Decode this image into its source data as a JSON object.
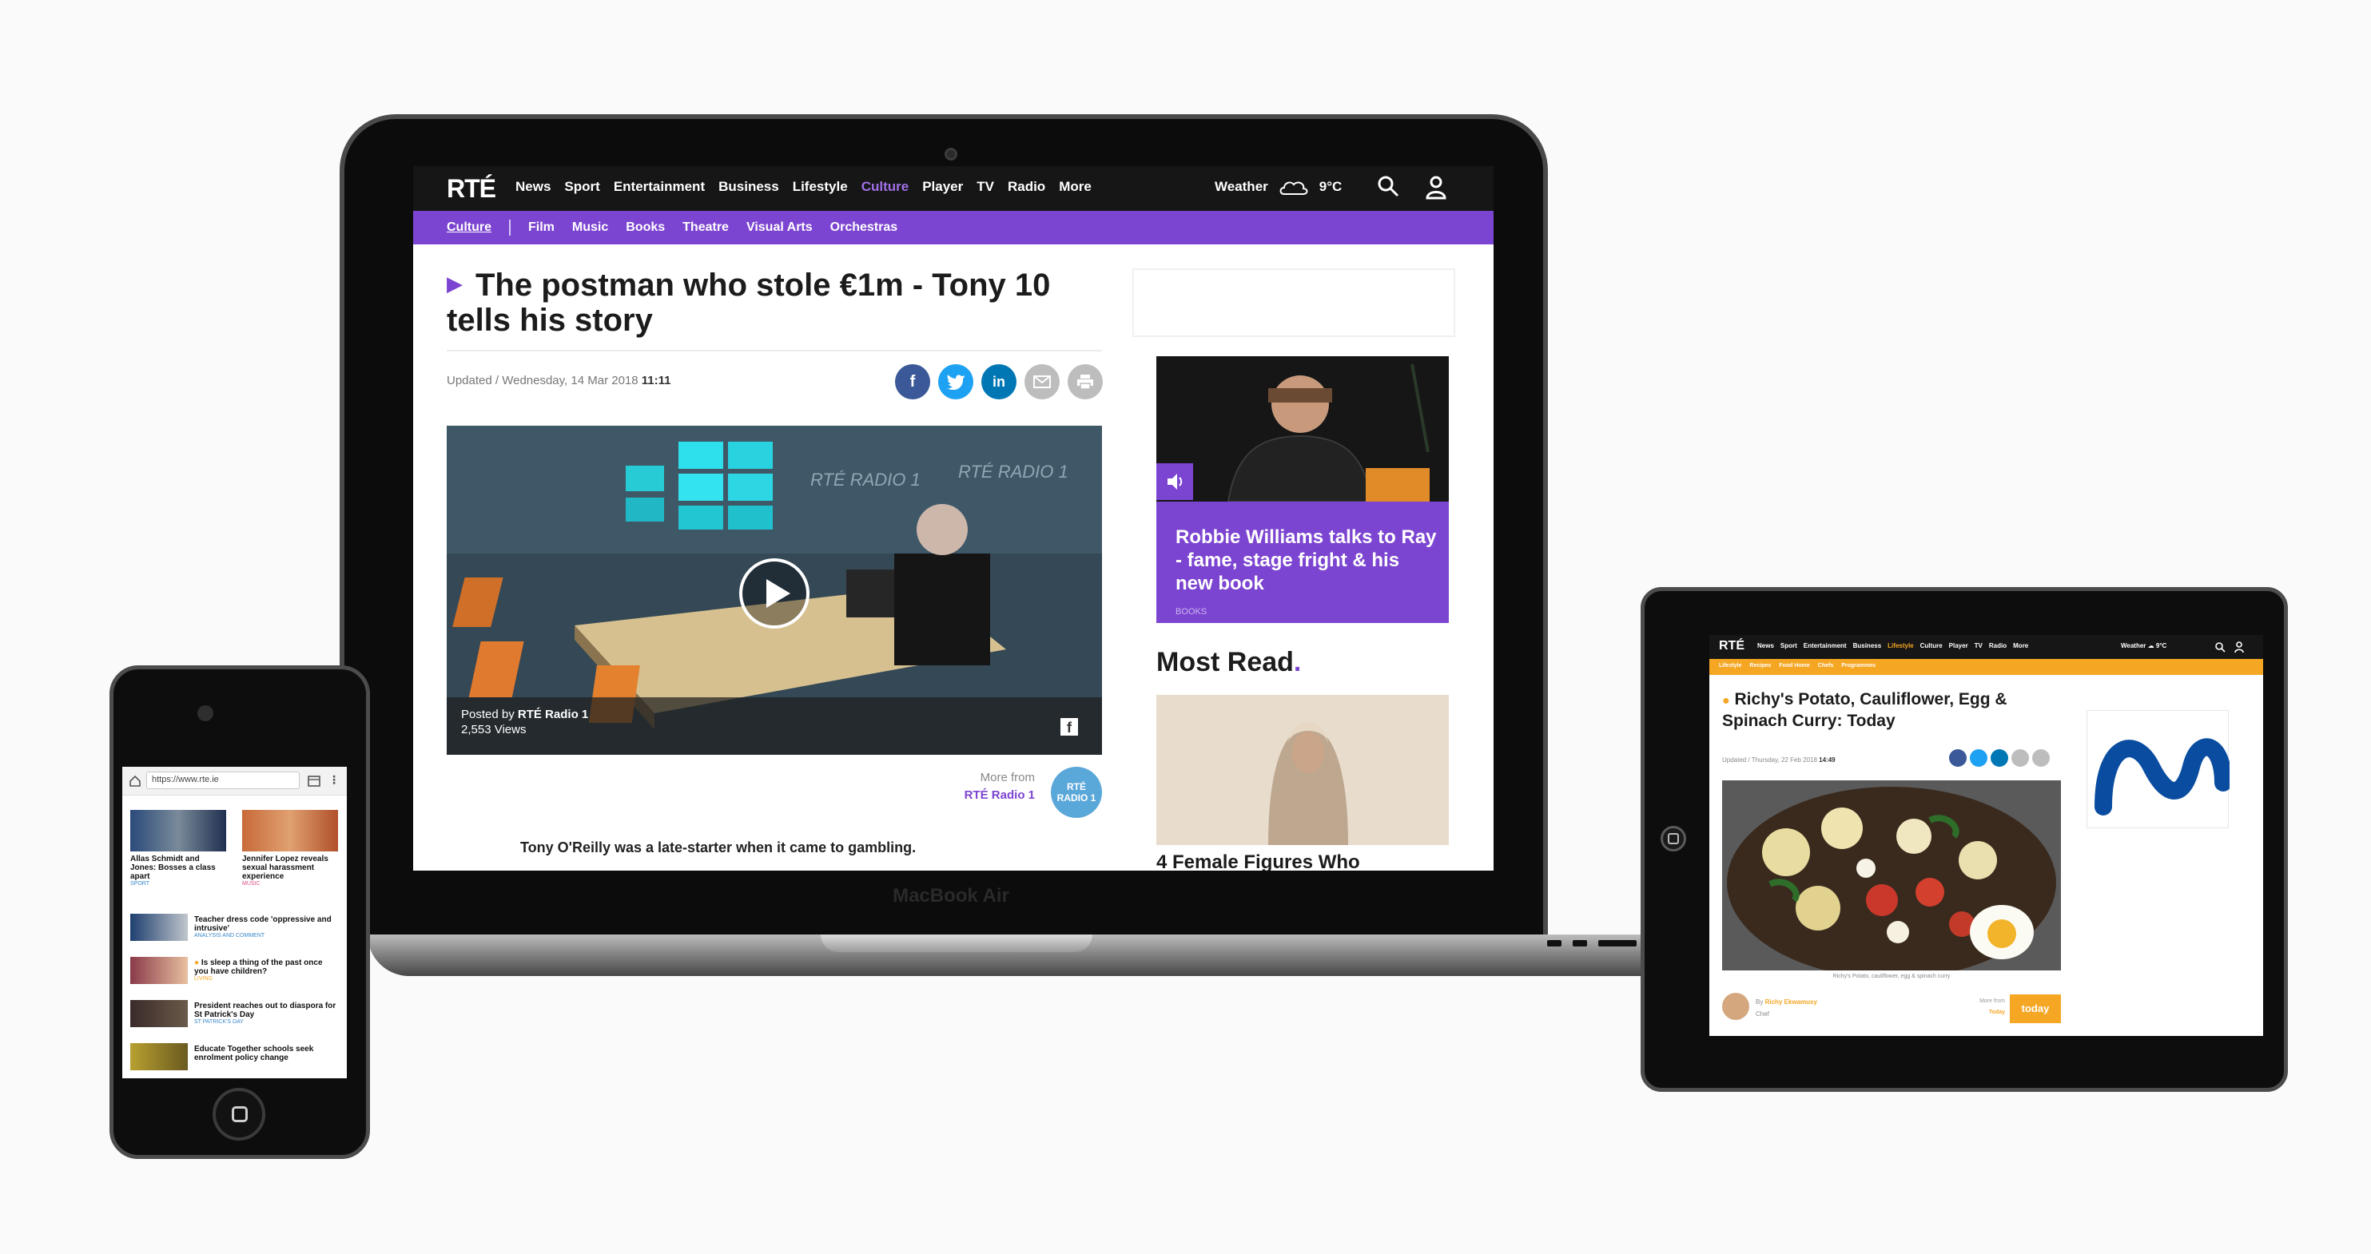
{
  "laptop": {
    "brand": "MacBook Air",
    "header": {
      "logo": "RTÉ",
      "nav": [
        "News",
        "Sport",
        "Entertainment",
        "Business",
        "Lifestyle",
        "Culture",
        "Player",
        "TV",
        "Radio",
        "More"
      ],
      "active_nav": "Culture",
      "weather_label": "Weather",
      "temperature": "9°C"
    },
    "subnav": [
      "Culture",
      "Film",
      "Music",
      "Books",
      "Theatre",
      "Visual Arts",
      "Orchestras"
    ],
    "article": {
      "title": "The postman who stole €1m - Tony 10 tells his story",
      "updated_prefix": "Updated / Wednesday, 14 Mar 2018",
      "updated_time": "11:11",
      "video_posted_prefix": "Posted by",
      "video_posted_by": "RTÉ Radio 1",
      "video_views": "2,553 Views",
      "more_from_label": "More from",
      "more_from_source": "RTÉ Radio 1",
      "radio_badge_line1": "RTÉ",
      "radio_badge_line2": "RADIO 1",
      "lead": "Tony O'Reilly was a late-starter when it came to gambling."
    },
    "promo": {
      "title": "Robbie Williams talks to Ray - fame, stage fright & his new book",
      "tag": "BOOKS"
    },
    "most_read": {
      "heading": "Most Read",
      "heading_dot": ".",
      "first_title": "4 Female Figures Who"
    }
  },
  "phone": {
    "url": "https://www.rte.ie",
    "cards": [
      {
        "title": "Allas Schmidt and Jones: Bosses a class apart",
        "tag": "SPORT"
      },
      {
        "title": "Jennifer Lopez reveals sexual harassment experience",
        "tag": "MUSIC"
      }
    ],
    "list": [
      {
        "title": "Teacher dress code 'oppressive and intrusive'",
        "tag": "ANALYSIS AND COMMENT"
      },
      {
        "title": "Is sleep a thing of the past once you have children?",
        "tag": "LIVING"
      },
      {
        "title": "President reaches out to diaspora for St Patrick's Day",
        "tag": "ST PATRICK'S DAY"
      },
      {
        "title": "Educate Together schools seek enrolment policy change",
        "tag": ""
      }
    ]
  },
  "tablet": {
    "header": {
      "logo": "RTÉ",
      "nav": [
        "News",
        "Sport",
        "Entertainment",
        "Business",
        "Lifestyle",
        "Culture",
        "Player",
        "TV",
        "Radio",
        "More"
      ],
      "active_nav": "Lifestyle",
      "weather": "Weather",
      "temperature": "9°C"
    },
    "subnav": [
      "Lifestyle",
      "Recipes",
      "Food Home",
      "Chefs",
      "Programmes"
    ],
    "article": {
      "title": "Richy's Potato, Cauliflower, Egg & Spinach Curry: Today",
      "updated_prefix": "Updated / Thursday, 22 Feb 2018",
      "updated_time": "14:49",
      "caption": "Richy's Potato, cauliflower, egg & spinach curry",
      "by_prefix": "By",
      "author": "Richy Ekwamusy",
      "author_role": "Chef",
      "more_from_label": "More from",
      "more_from_source": "Today",
      "badge": "today"
    }
  },
  "colors": {
    "culture_purple": "#7c45d1",
    "lifestyle_orange": "#f5a623",
    "header_dark": "#161616",
    "facebook": "#3b5998",
    "twitter": "#1da1f2",
    "linkedin": "#0077b5",
    "email": "#bdbdbd",
    "print": "#bdbdbd"
  }
}
